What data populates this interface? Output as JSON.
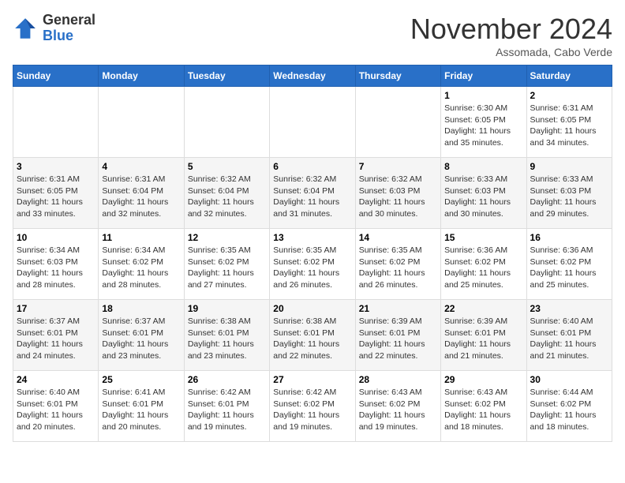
{
  "logo": {
    "general": "General",
    "blue": "Blue"
  },
  "header": {
    "month": "November 2024",
    "location": "Assomada, Cabo Verde"
  },
  "days_of_week": [
    "Sunday",
    "Monday",
    "Tuesday",
    "Wednesday",
    "Thursday",
    "Friday",
    "Saturday"
  ],
  "weeks": [
    [
      {
        "day": "",
        "info": ""
      },
      {
        "day": "",
        "info": ""
      },
      {
        "day": "",
        "info": ""
      },
      {
        "day": "",
        "info": ""
      },
      {
        "day": "",
        "info": ""
      },
      {
        "day": "1",
        "info": "Sunrise: 6:30 AM\nSunset: 6:05 PM\nDaylight: 11 hours and 35 minutes."
      },
      {
        "day": "2",
        "info": "Sunrise: 6:31 AM\nSunset: 6:05 PM\nDaylight: 11 hours and 34 minutes."
      }
    ],
    [
      {
        "day": "3",
        "info": "Sunrise: 6:31 AM\nSunset: 6:05 PM\nDaylight: 11 hours and 33 minutes."
      },
      {
        "day": "4",
        "info": "Sunrise: 6:31 AM\nSunset: 6:04 PM\nDaylight: 11 hours and 32 minutes."
      },
      {
        "day": "5",
        "info": "Sunrise: 6:32 AM\nSunset: 6:04 PM\nDaylight: 11 hours and 32 minutes."
      },
      {
        "day": "6",
        "info": "Sunrise: 6:32 AM\nSunset: 6:04 PM\nDaylight: 11 hours and 31 minutes."
      },
      {
        "day": "7",
        "info": "Sunrise: 6:32 AM\nSunset: 6:03 PM\nDaylight: 11 hours and 30 minutes."
      },
      {
        "day": "8",
        "info": "Sunrise: 6:33 AM\nSunset: 6:03 PM\nDaylight: 11 hours and 30 minutes."
      },
      {
        "day": "9",
        "info": "Sunrise: 6:33 AM\nSunset: 6:03 PM\nDaylight: 11 hours and 29 minutes."
      }
    ],
    [
      {
        "day": "10",
        "info": "Sunrise: 6:34 AM\nSunset: 6:03 PM\nDaylight: 11 hours and 28 minutes."
      },
      {
        "day": "11",
        "info": "Sunrise: 6:34 AM\nSunset: 6:02 PM\nDaylight: 11 hours and 28 minutes."
      },
      {
        "day": "12",
        "info": "Sunrise: 6:35 AM\nSunset: 6:02 PM\nDaylight: 11 hours and 27 minutes."
      },
      {
        "day": "13",
        "info": "Sunrise: 6:35 AM\nSunset: 6:02 PM\nDaylight: 11 hours and 26 minutes."
      },
      {
        "day": "14",
        "info": "Sunrise: 6:35 AM\nSunset: 6:02 PM\nDaylight: 11 hours and 26 minutes."
      },
      {
        "day": "15",
        "info": "Sunrise: 6:36 AM\nSunset: 6:02 PM\nDaylight: 11 hours and 25 minutes."
      },
      {
        "day": "16",
        "info": "Sunrise: 6:36 AM\nSunset: 6:02 PM\nDaylight: 11 hours and 25 minutes."
      }
    ],
    [
      {
        "day": "17",
        "info": "Sunrise: 6:37 AM\nSunset: 6:01 PM\nDaylight: 11 hours and 24 minutes."
      },
      {
        "day": "18",
        "info": "Sunrise: 6:37 AM\nSunset: 6:01 PM\nDaylight: 11 hours and 23 minutes."
      },
      {
        "day": "19",
        "info": "Sunrise: 6:38 AM\nSunset: 6:01 PM\nDaylight: 11 hours and 23 minutes."
      },
      {
        "day": "20",
        "info": "Sunrise: 6:38 AM\nSunset: 6:01 PM\nDaylight: 11 hours and 22 minutes."
      },
      {
        "day": "21",
        "info": "Sunrise: 6:39 AM\nSunset: 6:01 PM\nDaylight: 11 hours and 22 minutes."
      },
      {
        "day": "22",
        "info": "Sunrise: 6:39 AM\nSunset: 6:01 PM\nDaylight: 11 hours and 21 minutes."
      },
      {
        "day": "23",
        "info": "Sunrise: 6:40 AM\nSunset: 6:01 PM\nDaylight: 11 hours and 21 minutes."
      }
    ],
    [
      {
        "day": "24",
        "info": "Sunrise: 6:40 AM\nSunset: 6:01 PM\nDaylight: 11 hours and 20 minutes."
      },
      {
        "day": "25",
        "info": "Sunrise: 6:41 AM\nSunset: 6:01 PM\nDaylight: 11 hours and 20 minutes."
      },
      {
        "day": "26",
        "info": "Sunrise: 6:42 AM\nSunset: 6:01 PM\nDaylight: 11 hours and 19 minutes."
      },
      {
        "day": "27",
        "info": "Sunrise: 6:42 AM\nSunset: 6:02 PM\nDaylight: 11 hours and 19 minutes."
      },
      {
        "day": "28",
        "info": "Sunrise: 6:43 AM\nSunset: 6:02 PM\nDaylight: 11 hours and 19 minutes."
      },
      {
        "day": "29",
        "info": "Sunrise: 6:43 AM\nSunset: 6:02 PM\nDaylight: 11 hours and 18 minutes."
      },
      {
        "day": "30",
        "info": "Sunrise: 6:44 AM\nSunset: 6:02 PM\nDaylight: 11 hours and 18 minutes."
      }
    ]
  ]
}
